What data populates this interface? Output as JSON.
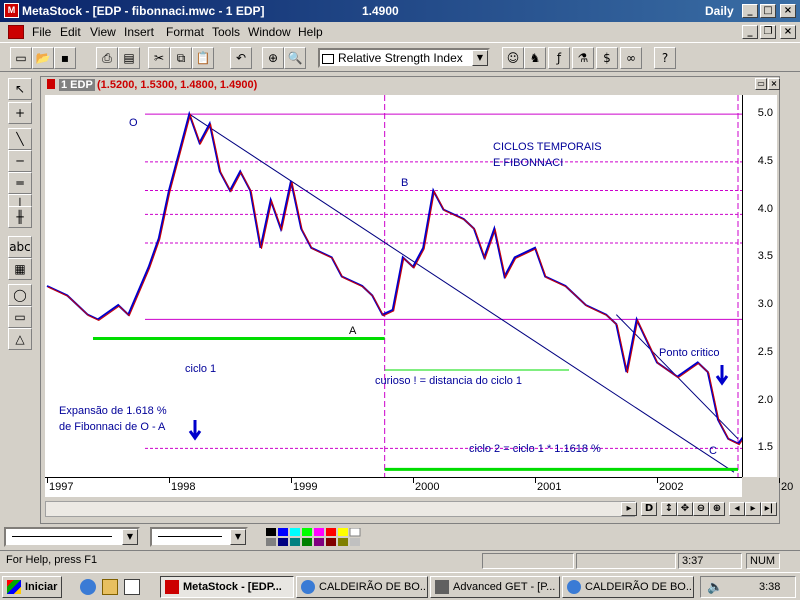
{
  "window": {
    "title": "MetaStock - [EDP - fibonnaci.mwc - 1 EDP]",
    "last_value": "1.4900",
    "periodicity": "Daily"
  },
  "menu": [
    "File",
    "Edit",
    "View",
    "Insert",
    "Format",
    "Tools",
    "Window",
    "Help"
  ],
  "toolbar": {
    "indicator_select": "Relative Strength Index"
  },
  "chart": {
    "header_label": "1 EDP",
    "header_ohlc": "(1.5200, 1.5300, 1.4800, 1.4900)",
    "y_ticks": [
      "5.0",
      "4.5",
      "4.0",
      "3.5",
      "3.0",
      "2.5",
      "2.0",
      "1.5"
    ],
    "x_ticks": [
      "1997",
      "1998",
      "1999",
      "2000",
      "2001",
      "2002",
      "20"
    ],
    "annotations": {
      "point_o": "O",
      "point_a": "A",
      "point_b": "B",
      "point_c": "C",
      "title_line1": "CICLOS TEMPORAIS",
      "title_line2": "E FIBONNACI",
      "ciclo1": "ciclo 1",
      "curioso": "curioso ! = distancia do ciclo 1",
      "ponto_critico": "Ponto critico",
      "expansao_line1": "Expansão de 1.618 %",
      "expansao_line2": "de Fibonnaci de O - A",
      "ciclo2": "ciclo 2 = ciclo 1 * 1.1618 %"
    },
    "colors": {
      "price": "#0000cc",
      "price_alt": "#cc0000",
      "fib_lines": "#cc00cc",
      "cycle_bars": "#00dd00",
      "trend_lines": "#000080",
      "annotation_text": "#000099"
    }
  },
  "chart_data": {
    "type": "line",
    "title": "1 EDP",
    "ylim": [
      1.2,
      5.2
    ],
    "y_ticks": [
      5.0,
      4.5,
      4.0,
      3.5,
      3.0,
      2.5,
      2.0,
      1.5
    ],
    "x_ticks": [
      "1997",
      "1998",
      "1999",
      "2000",
      "2001",
      "2002",
      "20"
    ],
    "series": [
      {
        "name": "EDP",
        "points": [
          [
            "1997-01",
            3.2
          ],
          [
            "1997-03",
            3.1
          ],
          [
            "1997-05",
            2.9
          ],
          [
            "1997-06",
            2.85
          ],
          [
            "1997-08",
            3.0
          ],
          [
            "1997-09",
            2.9
          ],
          [
            "1997-11",
            3.4
          ],
          [
            "1997-12",
            3.7
          ],
          [
            "1998-01",
            4.2
          ],
          [
            "1998-02",
            4.6
          ],
          [
            "1998-03",
            5.0
          ],
          [
            "1998-04",
            4.7
          ],
          [
            "1998-05",
            4.9
          ],
          [
            "1998-06",
            4.4
          ],
          [
            "1998-07",
            4.2
          ],
          [
            "1998-08",
            4.4
          ],
          [
            "1998-09",
            4.2
          ],
          [
            "1998-10",
            3.6
          ],
          [
            "1998-11",
            4.1
          ],
          [
            "1998-12",
            3.8
          ],
          [
            "1999-01",
            4.3
          ],
          [
            "1999-02",
            3.8
          ],
          [
            "1999-03",
            3.6
          ],
          [
            "1999-05",
            3.5
          ],
          [
            "1999-06",
            3.3
          ],
          [
            "1999-08",
            3.2
          ],
          [
            "1999-09",
            3.1
          ],
          [
            "1999-10",
            2.9
          ],
          [
            "1999-11",
            2.95
          ],
          [
            "1999-12",
            3.5
          ],
          [
            "2000-01",
            3.4
          ],
          [
            "2000-02",
            3.6
          ],
          [
            "2000-03",
            4.2
          ],
          [
            "2000-04",
            4.0
          ],
          [
            "2000-06",
            3.9
          ],
          [
            "2000-07",
            3.8
          ],
          [
            "2000-08",
            3.5
          ],
          [
            "2000-09",
            3.8
          ],
          [
            "2000-10",
            3.3
          ],
          [
            "2000-11",
            3.5
          ],
          [
            "2001-01",
            3.6
          ],
          [
            "2001-02",
            3.3
          ],
          [
            "2001-04",
            3.2
          ],
          [
            "2001-06",
            3.0
          ],
          [
            "2001-08",
            2.9
          ],
          [
            "2001-09",
            2.8
          ],
          [
            "2001-10",
            2.3
          ],
          [
            "2001-11",
            2.85
          ],
          [
            "2002-01",
            2.4
          ],
          [
            "2002-03",
            2.25
          ],
          [
            "2002-05",
            2.4
          ],
          [
            "2002-06",
            2.3
          ],
          [
            "2002-07",
            1.8
          ],
          [
            "2002-08",
            1.6
          ],
          [
            "2002-09",
            1.55
          ],
          [
            "2002-10",
            1.7
          ],
          [
            "2002-11",
            1.65
          ],
          [
            "2002-12",
            1.49
          ]
        ]
      }
    ],
    "fib_levels": [
      5.0,
      4.5,
      4.2,
      3.95,
      3.65,
      2.85,
      1.5
    ]
  },
  "statusbar": {
    "help": "For Help, press F1",
    "time": "3:37",
    "num": "NUM"
  },
  "taskbar": {
    "start": "Iniciar",
    "tasks": [
      "MetaStock - [EDP...",
      "CALDEIRÃO DE BO...",
      "Advanced GET - [P...",
      "CALDEIRÃO DE BO..."
    ],
    "clock": "3:38"
  }
}
